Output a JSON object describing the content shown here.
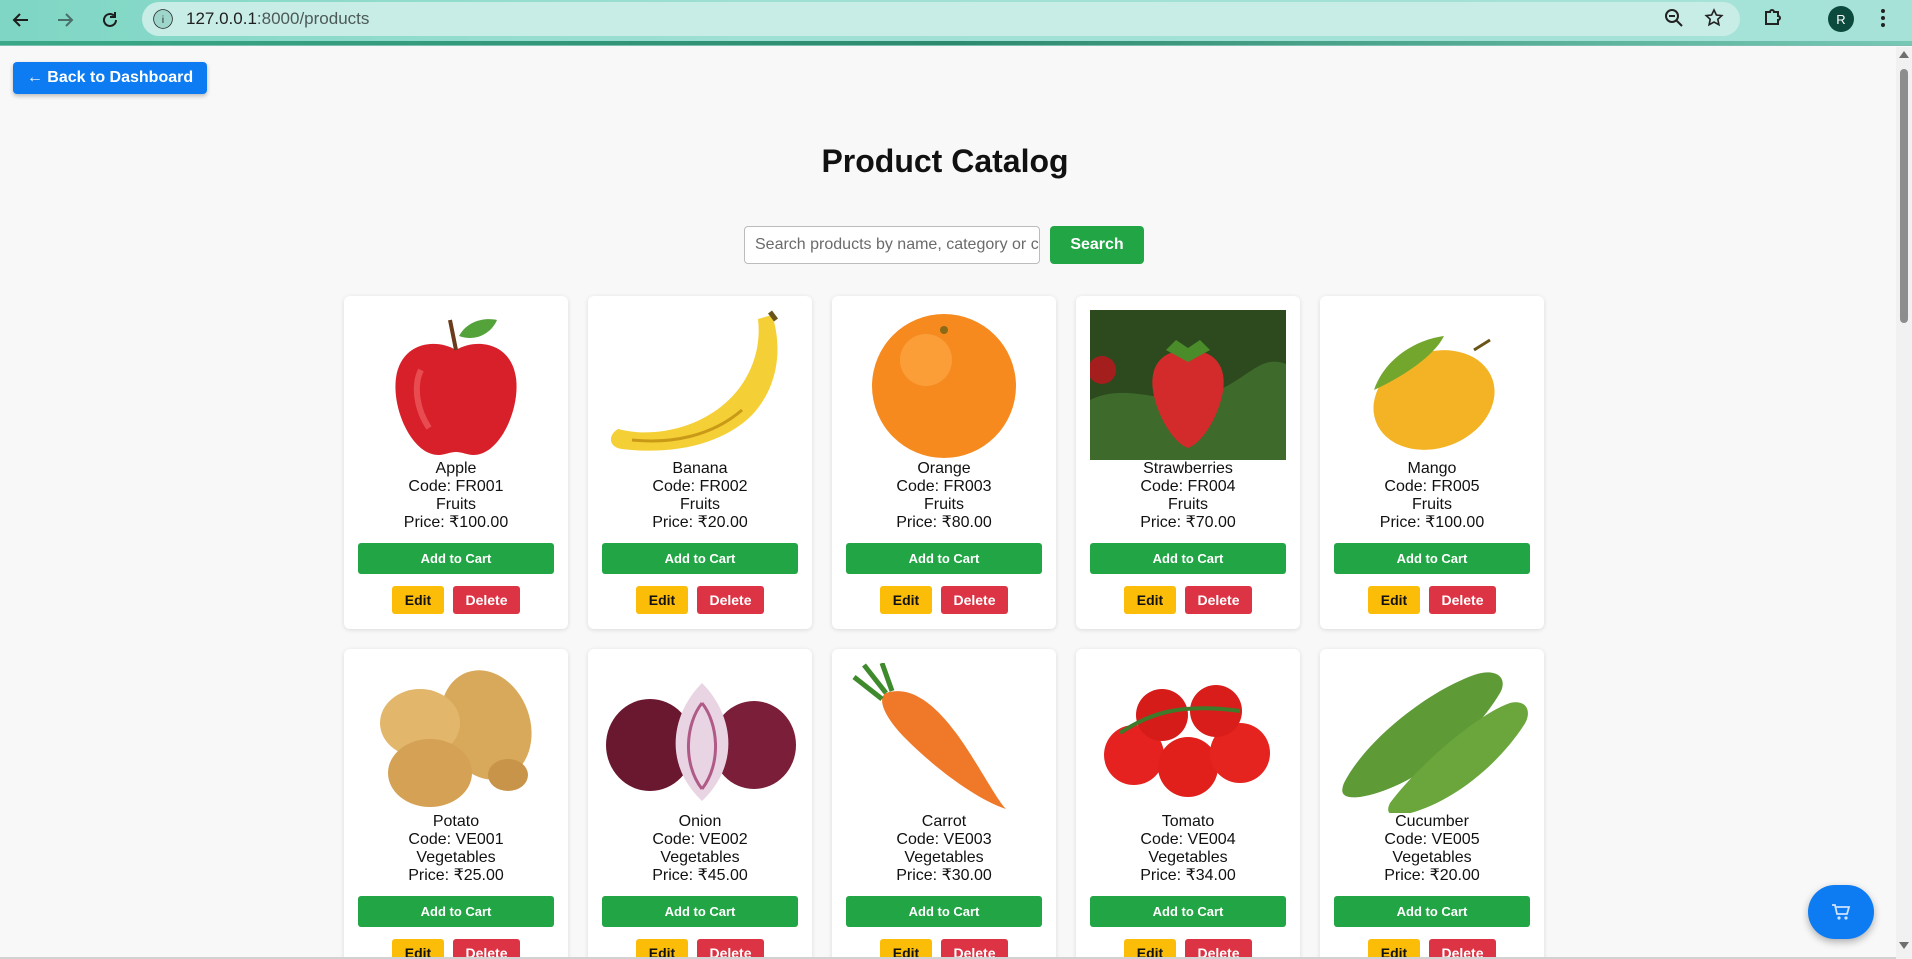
{
  "browser": {
    "url_host": "127.0.0.1",
    "url_rest": ":8000/products",
    "profile_initial": "R",
    "accent": "#9fe0d4"
  },
  "page": {
    "back_label": "← Back to Dashboard",
    "title": "Product Catalog",
    "search_placeholder": "Search products by name, category or code",
    "search_label": "Search",
    "add_to_cart_label": "Add to Cart",
    "edit_label": "Edit",
    "delete_label": "Delete"
  },
  "products": [
    {
      "name": "Apple",
      "code": "Code: FR001",
      "category": "Fruits",
      "price": "Price: ₹100.00",
      "image": "apple"
    },
    {
      "name": "Banana",
      "code": "Code: FR002",
      "category": "Fruits",
      "price": "Price: ₹20.00",
      "image": "banana"
    },
    {
      "name": "Orange",
      "code": "Code: FR003",
      "category": "Fruits",
      "price": "Price: ₹80.00",
      "image": "orange"
    },
    {
      "name": "Strawberries",
      "code": "Code: FR004",
      "category": "Fruits",
      "price": "Price: ₹70.00",
      "image": "strawberry"
    },
    {
      "name": "Mango",
      "code": "Code: FR005",
      "category": "Fruits",
      "price": "Price: ₹100.00",
      "image": "mango"
    },
    {
      "name": "Potato",
      "code": "Code: VE001",
      "category": "Vegetables",
      "price": "Price: ₹25.00",
      "image": "potato"
    },
    {
      "name": "Onion",
      "code": "Code: VE002",
      "category": "Vegetables",
      "price": "Price: ₹45.00",
      "image": "onion"
    },
    {
      "name": "Carrot",
      "code": "Code: VE003",
      "category": "Vegetables",
      "price": "Price: ₹30.00",
      "image": "carrot"
    },
    {
      "name": "Tomato",
      "code": "Code: VE004",
      "category": "Vegetables",
      "price": "Price: ₹34.00",
      "image": "tomato"
    },
    {
      "name": "Cucumber",
      "code": "Code: VE005",
      "category": "Vegetables",
      "price": "Price: ₹20.00",
      "image": "cucumber"
    }
  ],
  "colors": {
    "primary": "#0d7cf2",
    "success": "#22a544",
    "warning": "#fbbd08",
    "danger": "#dc3444"
  },
  "fab": {
    "icon": "cart-icon"
  }
}
